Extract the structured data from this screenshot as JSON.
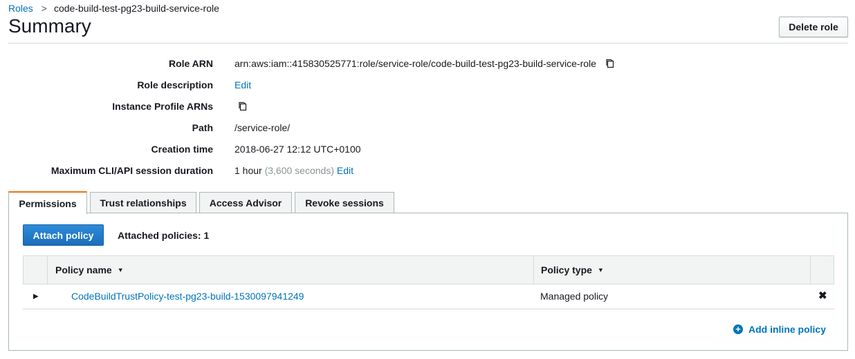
{
  "breadcrumb": {
    "parent": "Roles",
    "separator": ">",
    "current": "code-build-test-pg23-build-service-role"
  },
  "page_title": "Summary",
  "delete_role_label": "Delete role",
  "summary": {
    "role_arn_label": "Role ARN",
    "role_arn_value": "arn:aws:iam::415830525771:role/service-role/code-build-test-pg23-build-service-role",
    "role_description_label": "Role description",
    "role_description_edit": "Edit",
    "instance_profile_label": "Instance Profile ARNs",
    "path_label": "Path",
    "path_value": "/service-role/",
    "creation_time_label": "Creation time",
    "creation_time_value": "2018-06-27 12:12 UTC+0100",
    "session_duration_label": "Maximum CLI/API session duration",
    "session_duration_value": "1 hour",
    "session_duration_seconds": "(3,600 seconds)",
    "session_duration_edit": "Edit"
  },
  "tabs": [
    {
      "label": "Permissions",
      "active": true
    },
    {
      "label": "Trust relationships",
      "active": false
    },
    {
      "label": "Access Advisor",
      "active": false
    },
    {
      "label": "Revoke sessions",
      "active": false
    }
  ],
  "permissions": {
    "attach_policy_label": "Attach policy",
    "attached_count_text": "Attached policies: 1",
    "columns": [
      "Policy name",
      "Policy type"
    ],
    "rows": [
      {
        "policy_name": "CodeBuildTrustPolicy-test-pg23-build-1530097941249",
        "policy_type": "Managed policy"
      }
    ],
    "add_inline_label": "Add inline policy"
  },
  "icons": {
    "copy": "copy-icon",
    "sort": "caret-down-icon",
    "expand": "expand-triangle-icon",
    "remove": "remove-x-icon",
    "add": "plus-circle-icon"
  },
  "colors": {
    "link": "#0073bb",
    "primary_button": "#1a6ebd",
    "active_tab_accent": "#ec7211",
    "muted_text": "#879596"
  }
}
